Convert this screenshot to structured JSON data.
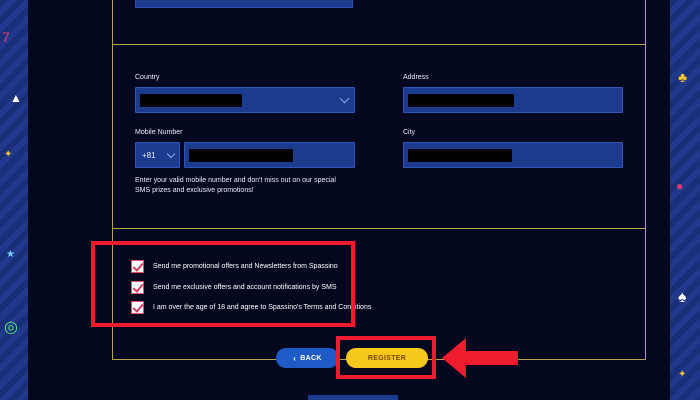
{
  "form": {
    "country": {
      "label": "Country",
      "value": ""
    },
    "address": {
      "label": "Address",
      "value": ""
    },
    "mobile": {
      "label": "Mobile Number",
      "country_code": "+81",
      "value": ""
    },
    "city": {
      "label": "City",
      "value": ""
    },
    "sms_hint_line1": "Enter your valid mobile number and don't miss out on our special",
    "sms_hint_line2": "SMS prizes and exclusive promotions!"
  },
  "consents": [
    {
      "label": "Send me promotional offers and Newsletters from Spassino",
      "checked": true
    },
    {
      "label": "Send me exclusive offers and account notifications by SMS",
      "checked": true
    },
    {
      "label": "I am over the age of 18 and agree to Spassino's Terms and Conditions",
      "checked": true
    }
  ],
  "buttons": {
    "back_label": "BACK",
    "back_icon": "chevron-left-icon",
    "register_label": "REGISTER"
  },
  "colors": {
    "panel_bg": "#03081f",
    "field_bg": "#1b3b8f",
    "frame_border": "#b9a34a",
    "highlight_red": "#ee1c2e",
    "register_yellow": "#f6c81a",
    "back_blue": "#1e5bc6"
  }
}
